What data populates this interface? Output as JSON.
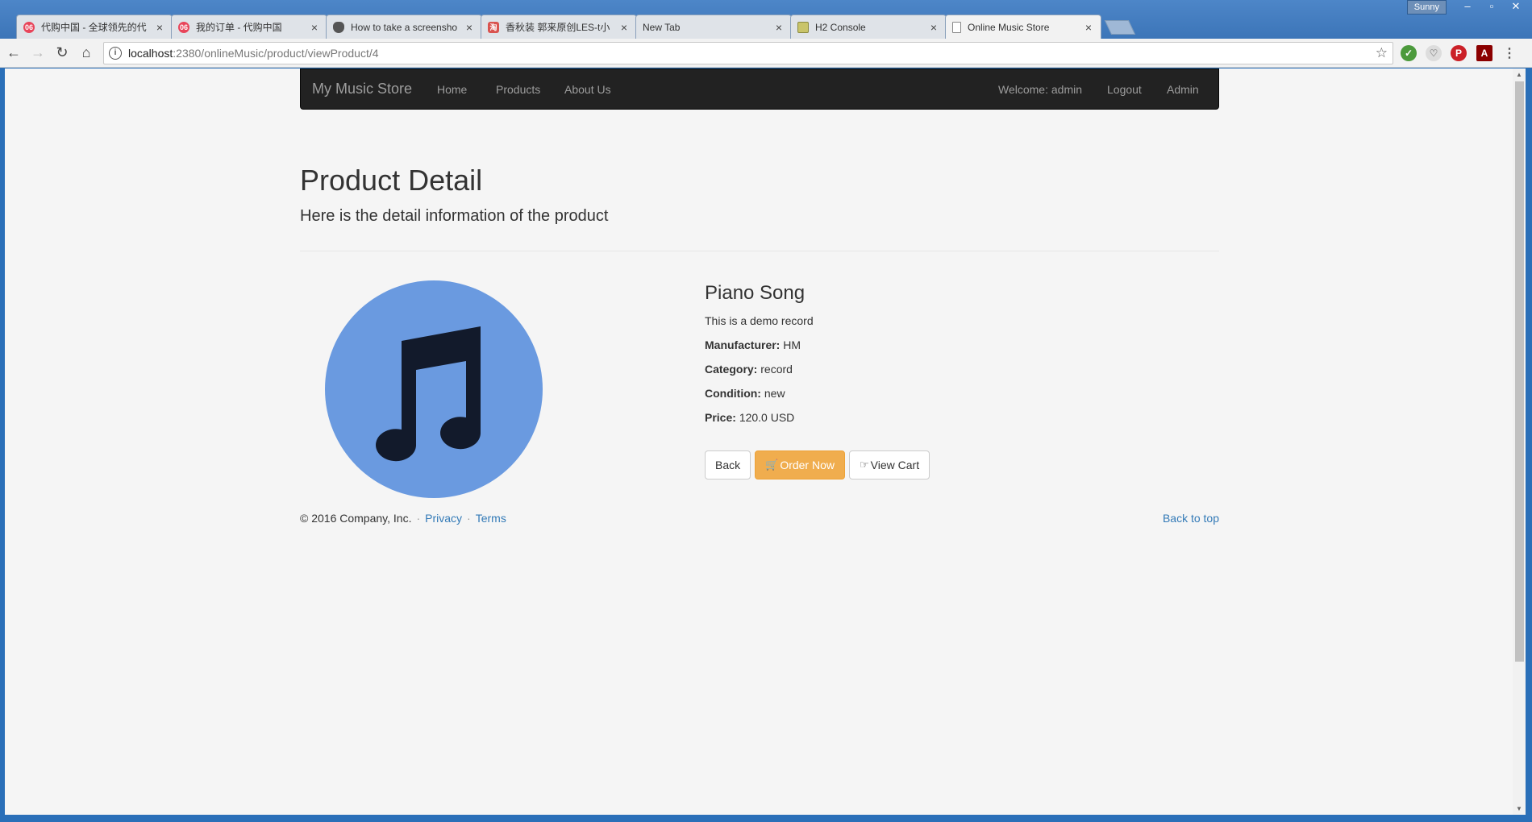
{
  "browser": {
    "tabs": [
      {
        "title": "代购中国 - 全球领先的代",
        "icon": "orange-circle-icon",
        "color": "#e8455a",
        "glyph": "06"
      },
      {
        "title": "我的订单 - 代购中国",
        "icon": "orange-circle-icon",
        "color": "#e8455a",
        "glyph": "06"
      },
      {
        "title": "How to take a screensho",
        "icon": "apple-icon",
        "color": "#555555",
        "glyph": ""
      },
      {
        "title": "香秋装 郭来原创LES-t小",
        "icon": "shop-icon",
        "color": "#d9534f",
        "glyph": "淘"
      },
      {
        "title": "New Tab",
        "icon": "",
        "color": "",
        "glyph": ""
      },
      {
        "title": "H2 Console",
        "icon": "h2-icon",
        "color": "#c9c46a",
        "glyph": ""
      },
      {
        "title": "Online Music Store",
        "icon": "page-icon",
        "color": "#888888",
        "glyph": ""
      }
    ],
    "user": "Sunny",
    "url_host": "localhost",
    "url_rest": ":2380/onlineMusic/product/viewProduct/4"
  },
  "nav": {
    "brand": "My Music Store",
    "home": "Home",
    "products": "Products",
    "about": "About Us",
    "welcome": "Welcome: admin",
    "logout": "Logout",
    "admin": "Admin"
  },
  "page": {
    "title": "Product Detail",
    "subtitle": "Here is the detail information of the product"
  },
  "product": {
    "name": "Piano Song",
    "description": "This is a demo record",
    "manufacturer_label": "Manufacturer:",
    "manufacturer": "HM",
    "category_label": "Category:",
    "category": "record",
    "condition_label": "Condition:",
    "condition": "new",
    "price_label": "Price:",
    "price": "120.0 USD",
    "image_icon": "music-note-icon",
    "image_color": "#6a9ae0"
  },
  "buttons": {
    "back": "Back",
    "order": "Order Now",
    "cart": "View Cart"
  },
  "footer": {
    "copyright": "© 2016 Company, Inc.",
    "privacy": "Privacy",
    "terms": "Terms",
    "back_to_top": "Back to top"
  }
}
